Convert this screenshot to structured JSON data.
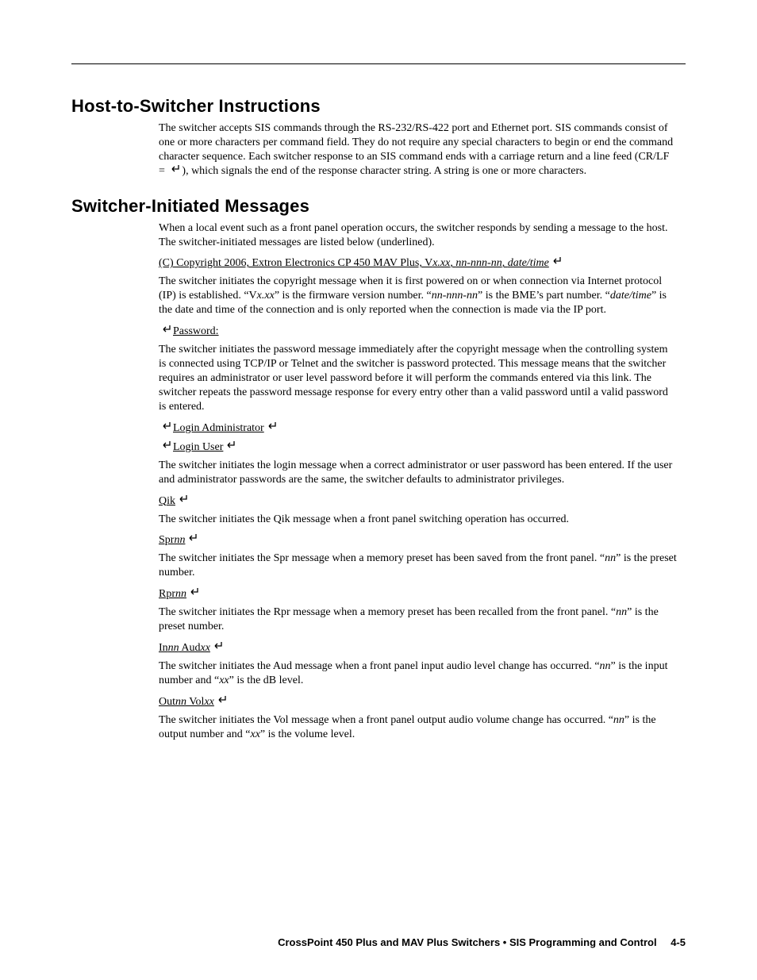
{
  "section1": {
    "title": "Host-to-Switcher Instructions",
    "para1_a": "The switcher accepts SIS commands through the RS-232/RS-422 port and Ethernet port.  SIS commands consist of one or more characters per command field.  They do not require any special characters to begin or end the command character sequence.  Each switcher response to an SIS command ends with a carriage return and a line feed (CR/LF = ",
    "para1_b": "), which signals the end of the response character string.  A string is one or more characters."
  },
  "section2": {
    "title": "Switcher-Initiated Messages",
    "intro": "When a local event such as a front panel operation occurs, the switcher responds by sending a message to the host.  The switcher-initiated messages are listed below (underlined).",
    "copyright_msg_a": "(C) Copyright 2006, Extron Electronics CP 450 MAV Plus, V",
    "copyright_msg_b": "x.xx",
    "copyright_msg_c": ", ",
    "copyright_msg_d": "nn-nnn-nn",
    "copyright_msg_e": ", ",
    "copyright_msg_f": "date/time",
    "copyright_para_a": "The switcher initiates the copyright message when it is first powered on or when connection via Internet protocol (IP) is established.  “V",
    "copyright_para_b": "x.xx",
    "copyright_para_c": "” is the firmware version number.  “",
    "copyright_para_d": "nn-nnn-nn",
    "copyright_para_e": "” is the BME’s part number.  “",
    "copyright_para_f": "date/time",
    "copyright_para_g": "” is the date and time of the connection and is only reported when the connection is made via the IP port.",
    "password_msg": "Password:",
    "password_para": "The switcher initiates the password message immediately after the copyright message when the controlling system is connected using TCP/IP or Telnet and the switcher is password protected.  This message means that the switcher requires an administrator or user level password before it will perform the commands entered via this link.  The switcher repeats the password message response for every entry other than a valid password until a valid password is entered.",
    "login_admin_msg": "Login Administrator",
    "login_user_msg": "Login User",
    "login_para": "The switcher initiates the login message when a correct administrator or user password has been entered.  If the user and administrator passwords are the same, the switcher defaults to administrator privileges.",
    "qik_msg": "Qik",
    "qik_para": "The switcher initiates the Qik message when a front panel switching operation has occurred.",
    "spr_msg_a": "Spr",
    "spr_msg_b": "nn",
    "spr_para_a": "The switcher initiates the Spr message when a memory preset has been saved from the front panel.  “",
    "spr_para_b": "nn",
    "spr_para_c": "” is the preset number.",
    "rpr_msg_a": "Rpr",
    "rpr_msg_b": "nn",
    "rpr_para_a": "The switcher initiates the Rpr message when a memory preset has been recalled from the front panel.  “",
    "rpr_para_b": "nn",
    "rpr_para_c": "” is the preset number.",
    "aud_msg_a": "In",
    "aud_msg_b": "nn",
    "aud_msg_c": " Aud",
    "aud_msg_d": "xx",
    "aud_para_a": "The switcher initiates the Aud message when a front panel input audio level change has occurred.  “",
    "aud_para_b": "nn",
    "aud_para_c": "” is the input number and “",
    "aud_para_d": "xx",
    "aud_para_e": "” is the dB level.",
    "vol_msg_a": "Out",
    "vol_msg_b": "nn",
    "vol_msg_c": " Vol",
    "vol_msg_d": "xx",
    "vol_para_a": "The switcher initiates the Vol message when a front panel output audio volume change has occurred.  “",
    "vol_para_b": "nn",
    "vol_para_c": "” is the output number and “",
    "vol_para_d": "xx",
    "vol_para_e": "” is the volume level."
  },
  "footer": {
    "text": "CrossPoint 450 Plus and MAV Plus Switchers • SIS Programming and Control",
    "page": "4-5"
  }
}
